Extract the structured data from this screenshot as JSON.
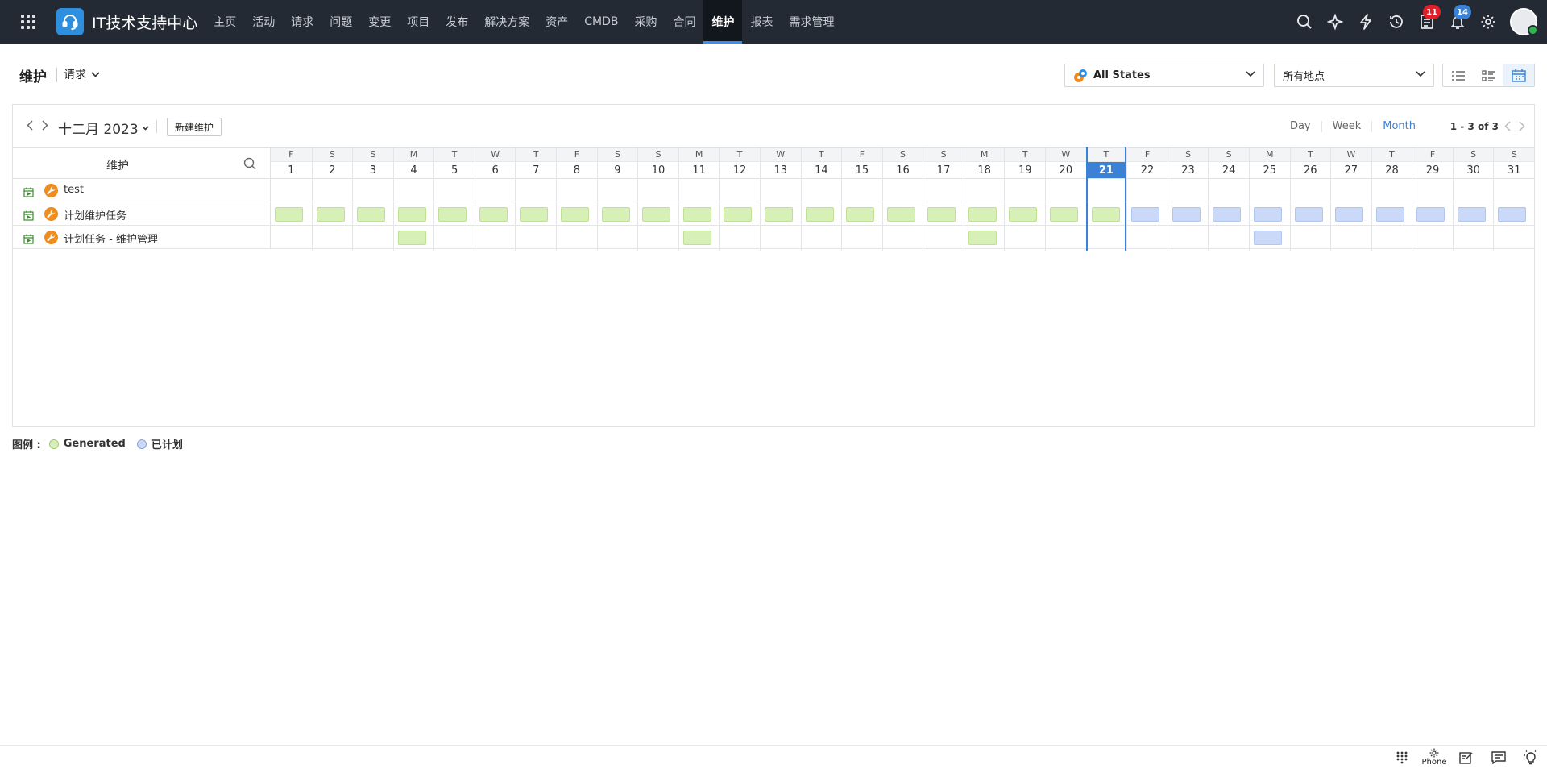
{
  "app": {
    "title": "IT技术支持中心"
  },
  "nav": {
    "items": [
      {
        "label": "主页",
        "name": "nav-home"
      },
      {
        "label": "活动",
        "name": "nav-activities"
      },
      {
        "label": "请求",
        "name": "nav-requests"
      },
      {
        "label": "问题",
        "name": "nav-problems"
      },
      {
        "label": "变更",
        "name": "nav-changes"
      },
      {
        "label": "项目",
        "name": "nav-projects"
      },
      {
        "label": "发布",
        "name": "nav-releases"
      },
      {
        "label": "解决方案",
        "name": "nav-solutions"
      },
      {
        "label": "资产",
        "name": "nav-assets"
      },
      {
        "label": "CMDB",
        "name": "nav-cmdb"
      },
      {
        "label": "采购",
        "name": "nav-purchase"
      },
      {
        "label": "合同",
        "name": "nav-contracts"
      },
      {
        "label": "维护",
        "name": "nav-maintenance",
        "active": true
      },
      {
        "label": "报表",
        "name": "nav-reports"
      },
      {
        "label": "需求管理",
        "name": "nav-demand-management"
      }
    ]
  },
  "header_icons": {
    "search": "search-icon",
    "quick_create": "quick-create-icon",
    "actions": "lightning-icon",
    "history": "history-icon",
    "tasks_badge": "11",
    "notifications_badge": "14",
    "settings": "gear-icon"
  },
  "subheader": {
    "title": "维护",
    "module": "请求",
    "state_filter": "All States",
    "location_filter": "所有地点"
  },
  "toolbar": {
    "month_label": "十二月 2023",
    "new_button": "新建维护",
    "ranges": [
      {
        "label": "Day",
        "active": false
      },
      {
        "label": "Week",
        "active": false
      },
      {
        "label": "Month",
        "active": true
      }
    ],
    "pager": "1 - 3 of 3"
  },
  "grid": {
    "column_title": "维护",
    "today": 21,
    "days": [
      {
        "dow": "F",
        "dom": "1"
      },
      {
        "dow": "S",
        "dom": "2"
      },
      {
        "dow": "S",
        "dom": "3"
      },
      {
        "dow": "M",
        "dom": "4"
      },
      {
        "dow": "T",
        "dom": "5"
      },
      {
        "dow": "W",
        "dom": "6"
      },
      {
        "dow": "T",
        "dom": "7"
      },
      {
        "dow": "F",
        "dom": "8"
      },
      {
        "dow": "S",
        "dom": "9"
      },
      {
        "dow": "S",
        "dom": "10"
      },
      {
        "dow": "M",
        "dom": "11"
      },
      {
        "dow": "T",
        "dom": "12"
      },
      {
        "dow": "W",
        "dom": "13"
      },
      {
        "dow": "T",
        "dom": "14"
      },
      {
        "dow": "F",
        "dom": "15"
      },
      {
        "dow": "S",
        "dom": "16"
      },
      {
        "dow": "S",
        "dom": "17"
      },
      {
        "dow": "M",
        "dom": "18"
      },
      {
        "dow": "T",
        "dom": "19"
      },
      {
        "dow": "W",
        "dom": "20"
      },
      {
        "dow": "T",
        "dom": "21"
      },
      {
        "dow": "F",
        "dom": "22"
      },
      {
        "dow": "S",
        "dom": "23"
      },
      {
        "dow": "S",
        "dom": "24"
      },
      {
        "dow": "M",
        "dom": "25"
      },
      {
        "dow": "T",
        "dom": "26"
      },
      {
        "dow": "W",
        "dom": "27"
      },
      {
        "dow": "T",
        "dom": "28"
      },
      {
        "dow": "F",
        "dom": "29"
      },
      {
        "dow": "S",
        "dom": "30"
      },
      {
        "dow": "S",
        "dom": "31"
      }
    ],
    "rows": [
      {
        "label": "test",
        "generated": [],
        "planned": []
      },
      {
        "label": "计划维护任务",
        "generated": [
          1,
          2,
          3,
          4,
          5,
          6,
          7,
          8,
          9,
          10,
          11,
          12,
          13,
          14,
          15,
          16,
          17,
          18,
          19,
          20,
          21
        ],
        "planned": [
          22,
          23,
          24,
          25,
          26,
          27,
          28,
          29,
          30,
          31
        ]
      },
      {
        "label": "计划任务 - 维护管理",
        "generated": [
          4,
          11,
          18
        ],
        "planned": [
          25
        ]
      }
    ]
  },
  "legend": {
    "title": "图例 :",
    "generated": "Generated",
    "planned": "已计划"
  },
  "colors": {
    "topbar": "#232a33",
    "accent": "#3b82d6",
    "generated": "#d7f0b8",
    "planned": "#cad9f7",
    "wrench": "#f08c1e"
  },
  "bottombar": {
    "phone_label": "Phone"
  }
}
